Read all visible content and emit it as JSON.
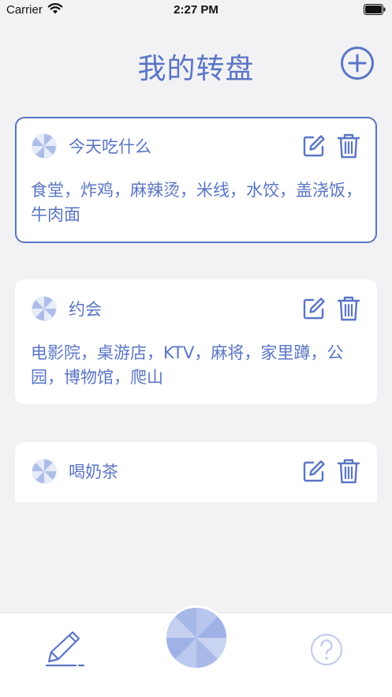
{
  "status_bar": {
    "carrier": "Carrier",
    "time": "2:27 PM"
  },
  "header": {
    "title": "我的转盘"
  },
  "wheels": [
    {
      "title": "今天吃什么",
      "options": "食堂，炸鸡，麻辣烫，米线，水饺，盖浇饭，牛肉面",
      "selected": true
    },
    {
      "title": "约会",
      "options": "电影院，桌游店，KTV，麻将，家里蹲，公园，博物馆，爬山",
      "selected": false
    },
    {
      "title": "喝奶茶",
      "options": "",
      "selected": false
    }
  ],
  "colors": {
    "accent": "#5a75c4",
    "background": "#f2f2f5",
    "card": "#ffffff"
  },
  "icons": {
    "add": "plus-circle-icon",
    "edit": "edit-icon",
    "delete": "trash-icon",
    "wheel": "wheel-icon",
    "tab_edit": "pencil-icon",
    "tab_spin": "spin-wheel-icon",
    "tab_help": "question-circle-icon"
  }
}
